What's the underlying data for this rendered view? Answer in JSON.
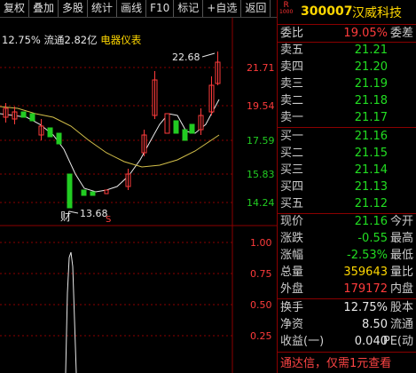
{
  "toolbar": {
    "items": [
      "复权",
      "叠加",
      "多股",
      "统计",
      "画线",
      "F10",
      "标记",
      "+自选",
      "返回"
    ]
  },
  "info": {
    "turnover": "12.75%",
    "float_cap": "流通2.82亿",
    "industry": "电器仪表"
  },
  "chart": {
    "price_labels": [
      "21.71",
      "19.54",
      "17.59",
      "15.83",
      "14.24"
    ],
    "high_label": "22.68",
    "low_label": "13.68",
    "marker_cai": "财",
    "marker_s": "S",
    "vol_labels": [
      "1.00",
      "0.75",
      "0.50",
      "0.25"
    ]
  },
  "quote": {
    "badge_r": "R",
    "badge_num": "1000",
    "code": "300007",
    "name": "汉威科技",
    "weibi_label": "委比",
    "weibi_value": "19.05%",
    "weicha_label": "委差",
    "sell": [
      {
        "label": "卖五",
        "price": "21.21"
      },
      {
        "label": "卖四",
        "price": "21.20"
      },
      {
        "label": "卖三",
        "price": "21.19"
      },
      {
        "label": "卖二",
        "price": "21.18"
      },
      {
        "label": "卖一",
        "price": "21.17"
      }
    ],
    "buy": [
      {
        "label": "买一",
        "price": "21.16"
      },
      {
        "label": "买二",
        "price": "21.15"
      },
      {
        "label": "买三",
        "price": "21.14"
      },
      {
        "label": "买四",
        "price": "21.13"
      },
      {
        "label": "买五",
        "price": "21.12"
      }
    ],
    "stats": [
      {
        "label": "现价",
        "value": "21.16",
        "label2": "今开",
        "color": "green"
      },
      {
        "label": "涨跌",
        "value": "-0.55",
        "label2": "最高",
        "color": "green"
      },
      {
        "label": "涨幅",
        "value": "-2.53%",
        "label2": "最低",
        "color": "green"
      },
      {
        "label": "总量",
        "value": "359643",
        "label2": "量比",
        "color": "yellow"
      },
      {
        "label": "外盘",
        "value": "179172",
        "label2": "内盘",
        "color": "red"
      }
    ],
    "stats2": [
      {
        "label": "换手",
        "value": "12.75%",
        "label2": "股本",
        "color": "white"
      },
      {
        "label": "净资",
        "value": "8.50",
        "label2": "流通",
        "color": "white"
      },
      {
        "label": "收益(一)",
        "value": "0.040",
        "label2": "PE(动",
        "color": "white"
      }
    ],
    "footer": "通达信，仅需1元查看"
  }
}
